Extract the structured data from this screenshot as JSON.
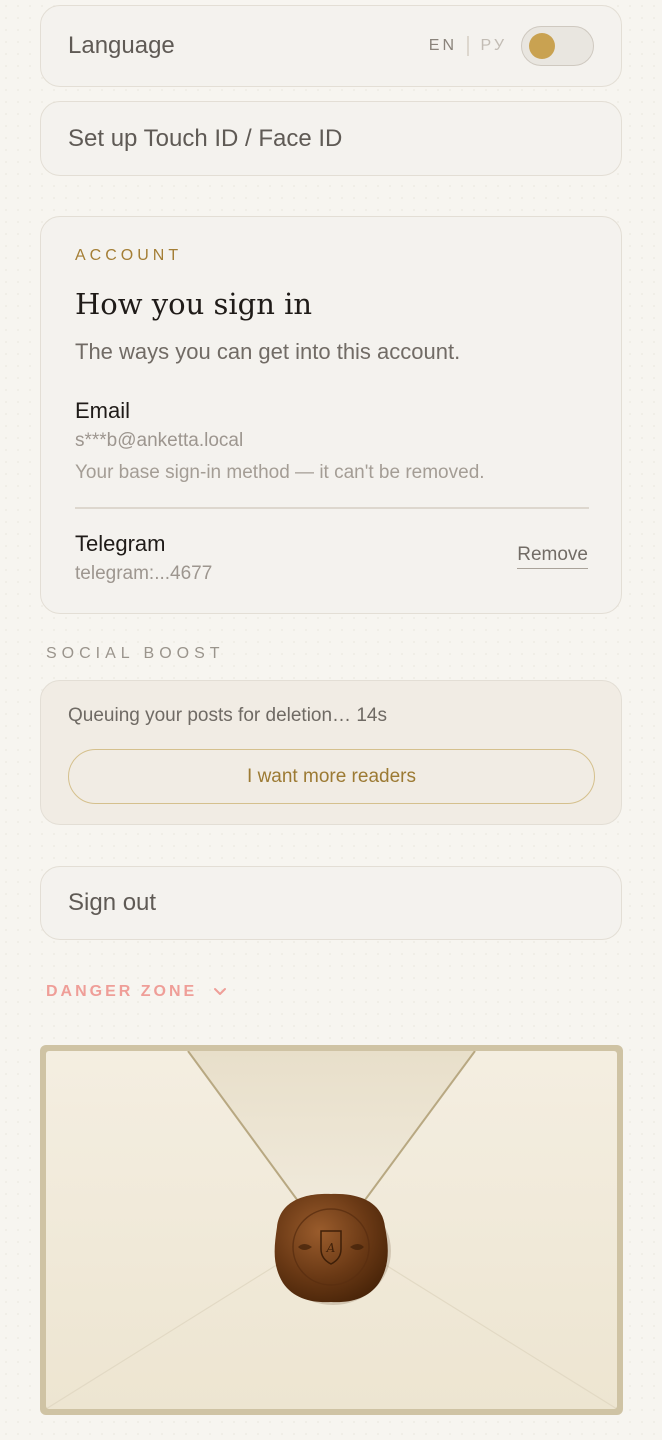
{
  "language": {
    "label": "Language",
    "option_en": "EN",
    "option_ru": "РУ"
  },
  "biometrics": {
    "label": "Set up Touch ID / Face ID"
  },
  "account": {
    "eyebrow": "ACCOUNT",
    "title": "How you sign in",
    "subtitle": "The ways you can get into this account.",
    "methods": [
      {
        "name": "Email",
        "value": "s***b@anketta.local",
        "note": "Your base sign-in method — it can't be removed."
      },
      {
        "name": "Telegram",
        "value": "telegram:...4677",
        "action": "Remove"
      }
    ]
  },
  "social_boost": {
    "label": "SOCIAL BOOST",
    "status": "Queuing your posts for deletion… 14s",
    "button": "I want more readers"
  },
  "sign_out": {
    "label": "Sign out"
  },
  "danger_zone": {
    "label": "DANGER ZONE"
  },
  "envelope": {
    "seal_letter": "A"
  },
  "colors": {
    "accent_gold": "#c9a251",
    "danger": "#ef9e98",
    "wax_seal": "#6a3915"
  },
  "icons": {
    "danger_toggle": "chevron-down-icon",
    "seal": "wax-seal-icon"
  }
}
